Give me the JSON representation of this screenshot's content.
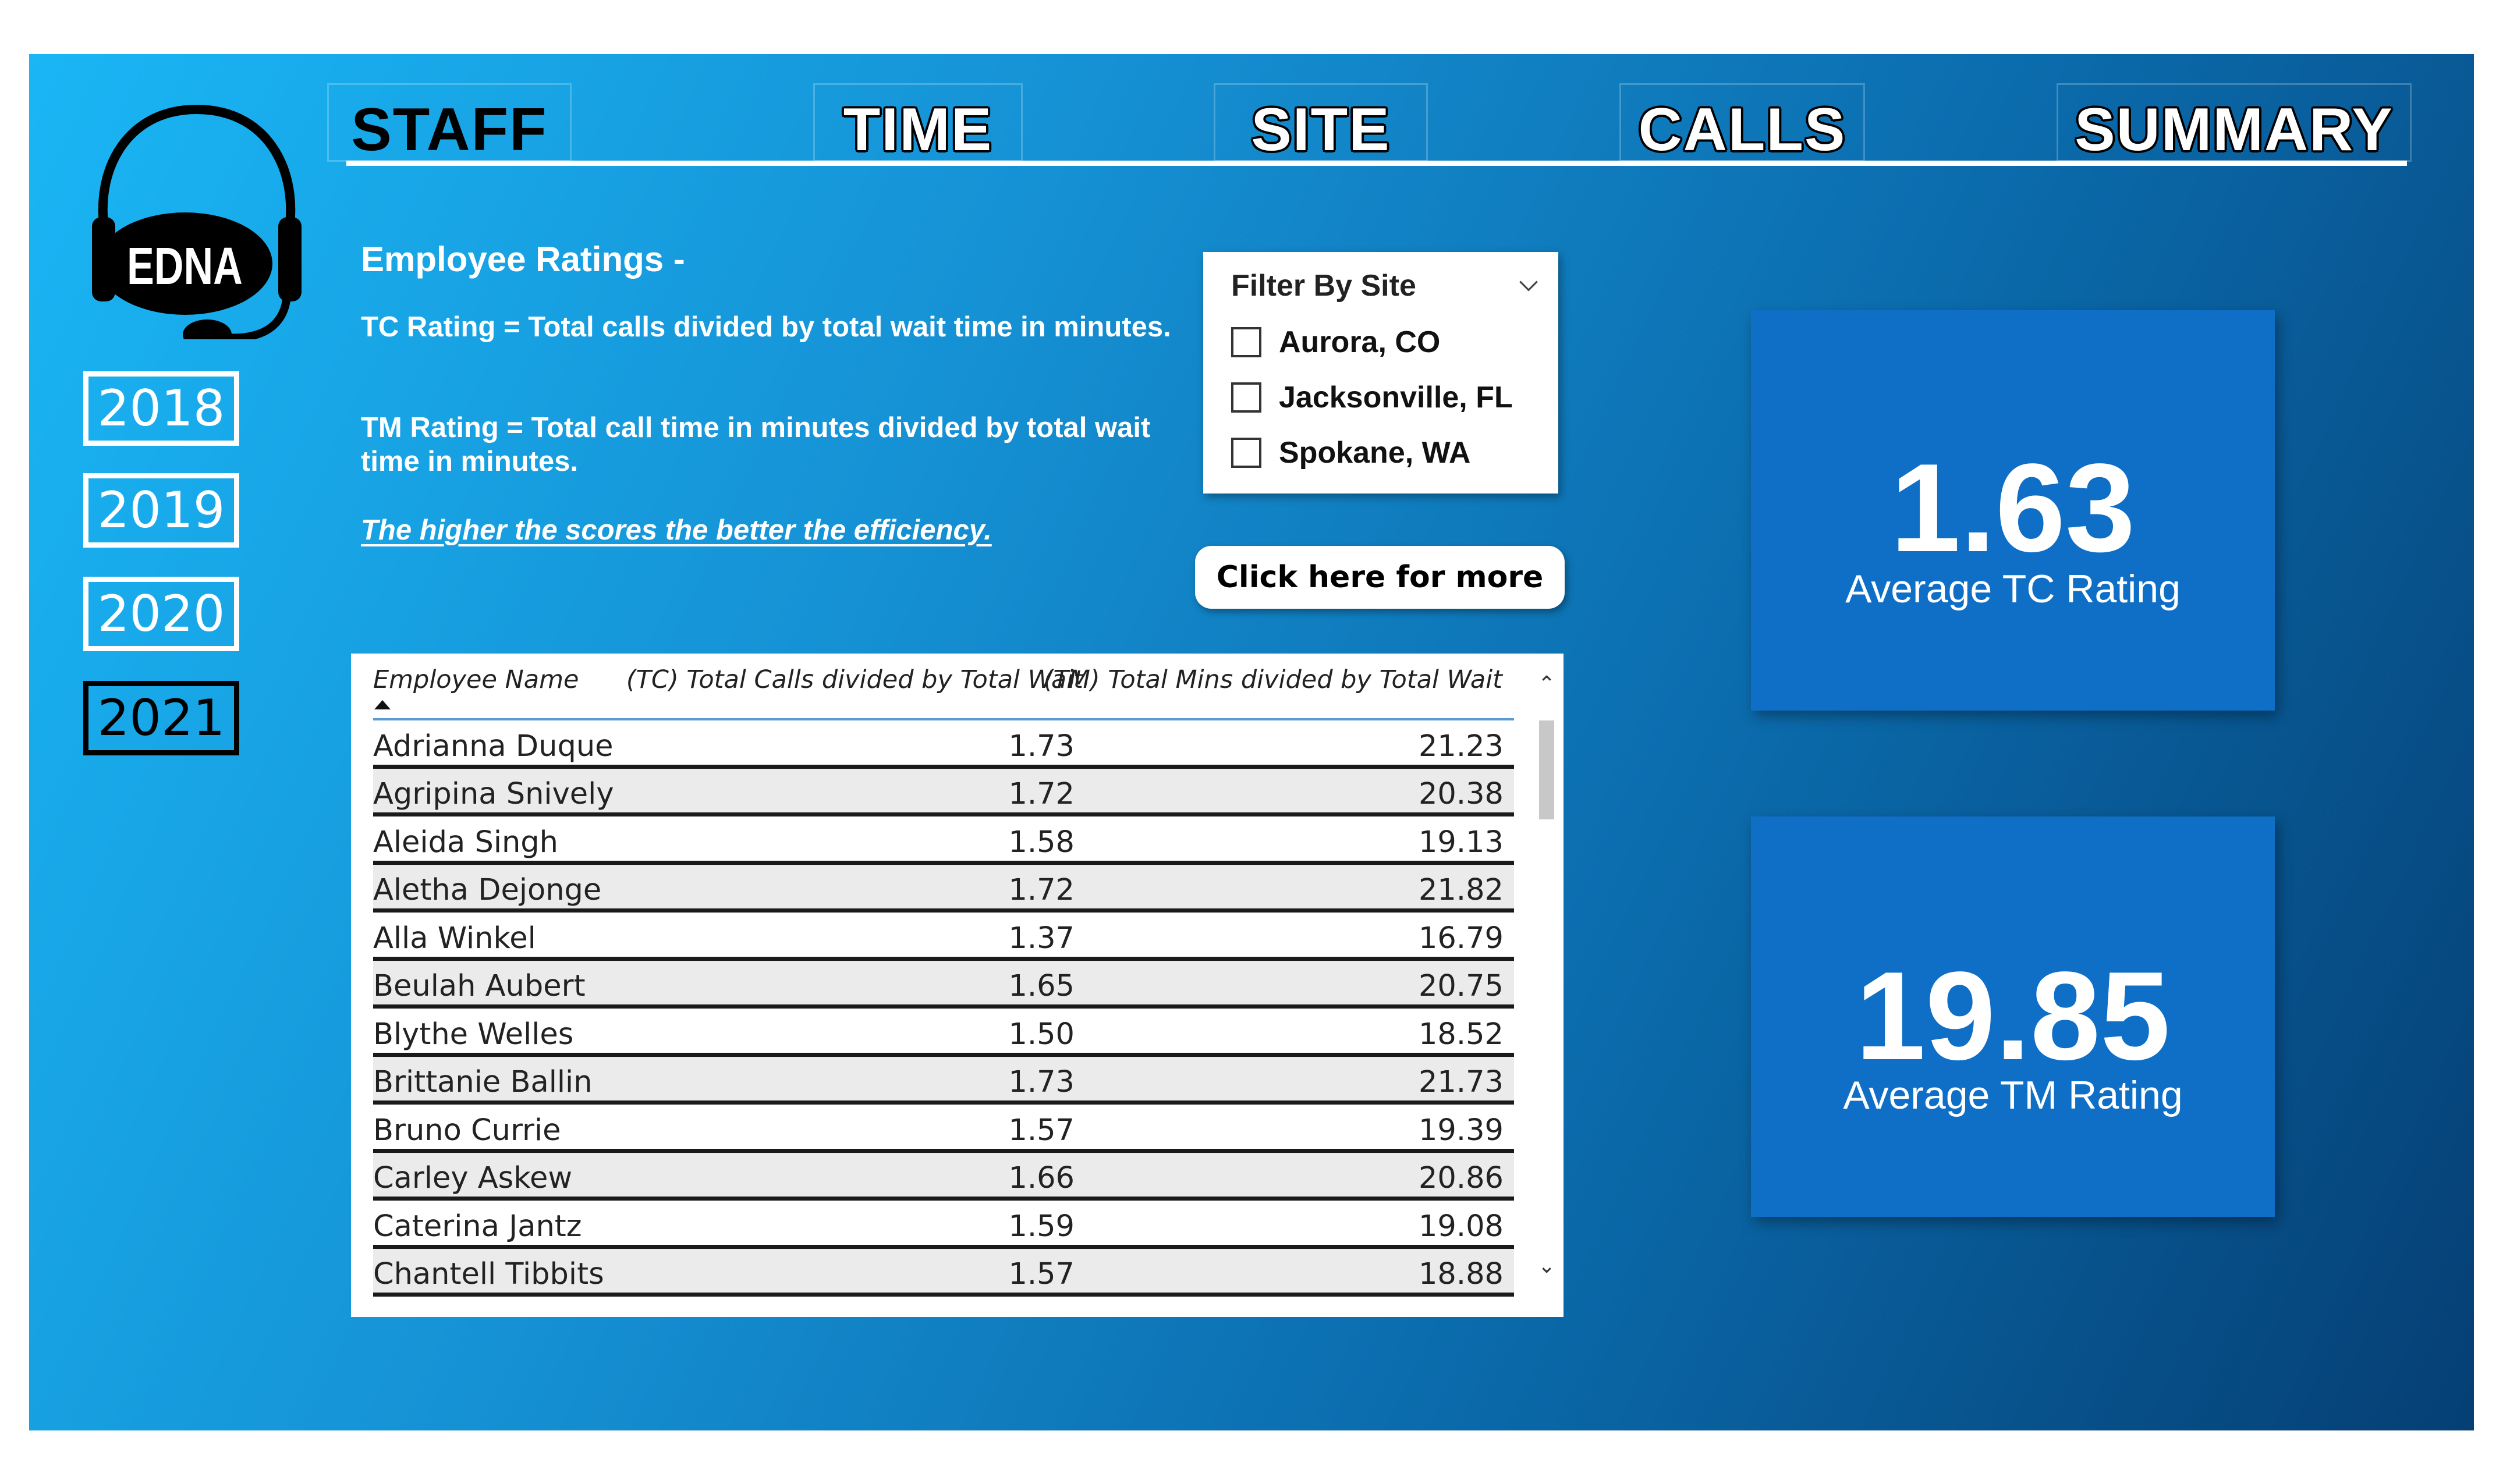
{
  "logo": {
    "text": "EDNA",
    "icon": "headset-icon"
  },
  "years": [
    "2018",
    "2019",
    "2020",
    "2021"
  ],
  "active_year": "2021",
  "nav": {
    "tabs": [
      "STAFF",
      "TIME",
      "SITE",
      "CALLS",
      "SUMMARY"
    ],
    "active": "STAFF"
  },
  "description": {
    "title": "Employee Ratings -",
    "tc_rating": "TC Rating = Total calls divided by total wait time in minutes.",
    "tm_rating": "TM Rating = Total call time in minutes divided by total wait time in minutes.",
    "note": "The higher the scores the better the efficiency."
  },
  "filter": {
    "title": "Filter By Site",
    "options": [
      "Aurora, CO",
      "Jacksonville, FL",
      "Spokane, WA"
    ]
  },
  "more_button": {
    "label": "Click here for more"
  },
  "table": {
    "columns": [
      "Employee Name",
      "(TC) Total Calls divided by Total Wait",
      "(TM) Total Mins divided by Total Wait"
    ],
    "rows": [
      [
        "Adrianna Duque",
        "1.73",
        "21.23"
      ],
      [
        "Agripina Snively",
        "1.72",
        "20.38"
      ],
      [
        "Aleida Singh",
        "1.58",
        "19.13"
      ],
      [
        "Aletha Dejonge",
        "1.72",
        "21.82"
      ],
      [
        "Alla Winkel",
        "1.37",
        "16.79"
      ],
      [
        "Beulah Aubert",
        "1.65",
        "20.75"
      ],
      [
        "Blythe Welles",
        "1.50",
        "18.52"
      ],
      [
        "Brittanie Ballin",
        "1.73",
        "21.73"
      ],
      [
        "Bruno Currie",
        "1.57",
        "19.39"
      ],
      [
        "Carley Askew",
        "1.66",
        "20.86"
      ],
      [
        "Caterina Jantz",
        "1.59",
        "19.08"
      ],
      [
        "Chantell Tibbits",
        "1.57",
        "18.88"
      ]
    ]
  },
  "kpi": {
    "tc": {
      "value": "1.63",
      "label": "Average TC Rating"
    },
    "tm": {
      "value": "19.85",
      "label": "Average TM Rating"
    }
  },
  "colors": {
    "gradient_start": "#1ab6f5",
    "gradient_end": "#053f74",
    "kpi_card": "#0f6fc6",
    "table_header_line": "#5b9bd5"
  }
}
